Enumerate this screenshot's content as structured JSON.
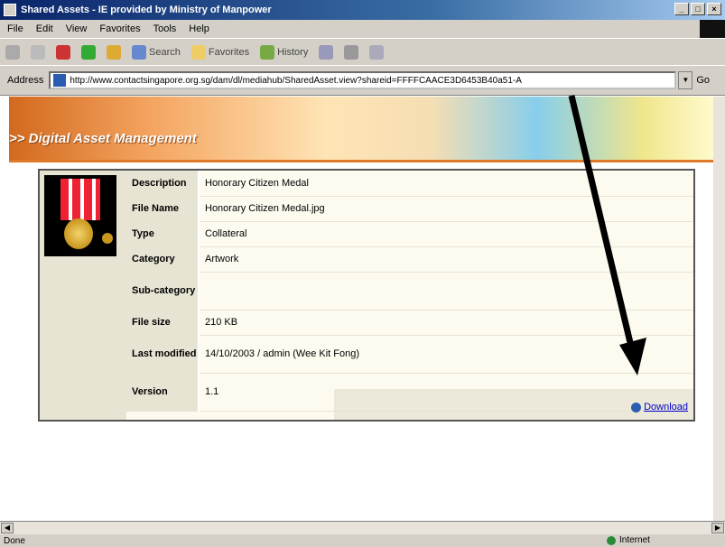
{
  "window": {
    "title": "Shared Assets - IE provided by Ministry of Manpower"
  },
  "menu": {
    "items": [
      "File",
      "Edit",
      "View",
      "Favorites",
      "Tools",
      "Help"
    ]
  },
  "toolbar": {
    "search": "Search",
    "favorites": "Favorites",
    "history": "History"
  },
  "address": {
    "label": "Address",
    "url": "http://www.contactsingapore.org.sg/dam/dl/mediahub/SharedAsset.view?shareid=FFFFCAACE3D6453B40a51-A",
    "go": "Go"
  },
  "banner": {
    "title": ">> Digital Asset Management"
  },
  "asset": {
    "properties": [
      {
        "key": "Description",
        "value": "Honorary Citizen Medal"
      },
      {
        "key": "File Name",
        "value": "Honorary Citizen Medal.jpg"
      },
      {
        "key": "Type",
        "value": "Collateral"
      },
      {
        "key": "Category",
        "value": "Artwork"
      },
      {
        "key": "Sub-category",
        "value": ""
      },
      {
        "key": "File size",
        "value": "210 KB"
      },
      {
        "key": "Last modified",
        "value": "14/10/2003 / admin (Wee Kit Fong)"
      },
      {
        "key": "Version",
        "value": "1.1"
      }
    ],
    "download": "Download"
  },
  "status": {
    "left": "Done",
    "zone": "Internet"
  }
}
